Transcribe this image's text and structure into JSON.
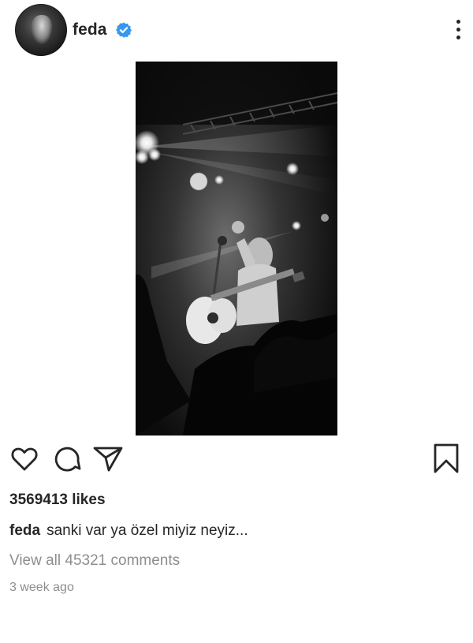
{
  "post": {
    "username": "feda",
    "verified": true,
    "avatar_icon": "profile-avatar",
    "more_icon": "more-options-icon",
    "image_description_icon": "concert-photo",
    "likes_text": "3569413 likes",
    "caption": {
      "username": "feda",
      "text": "sanki var ya özel miyiz neyiz..."
    },
    "comments_link": "View all 45321 comments",
    "timestamp": "3 week ago"
  },
  "actions": {
    "like_icon": "heart-icon",
    "comment_icon": "comment-icon",
    "share_icon": "send-icon",
    "save_icon": "bookmark-icon"
  },
  "colors": {
    "text": "#262626",
    "secondary_text": "#8e8e8e",
    "verified_blue": "#3897f0",
    "background": "#ffffff"
  }
}
